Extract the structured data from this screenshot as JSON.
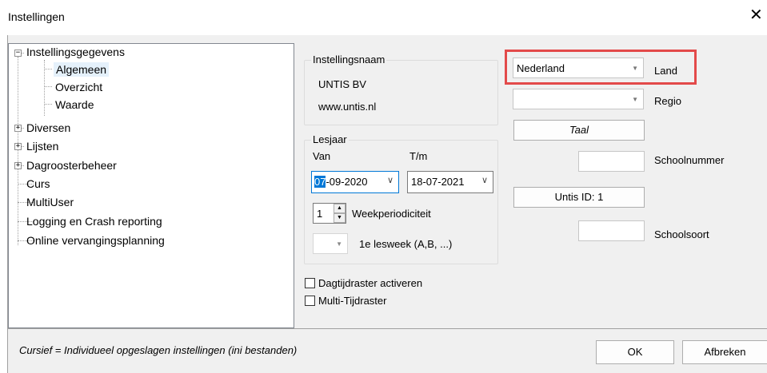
{
  "window": {
    "title": "Instellingen",
    "close_glyph": "✕"
  },
  "tree": {
    "items": [
      {
        "label": "Instellingsgegevens",
        "expander": "−"
      },
      {
        "label": "Algemeen"
      },
      {
        "label": "Overzicht"
      },
      {
        "label": "Waarde"
      },
      {
        "label": "Diversen",
        "expander": "+"
      },
      {
        "label": "Lijsten",
        "expander": "+"
      },
      {
        "label": "Dagroosterbeheer",
        "expander": "+"
      },
      {
        "label": "Curs"
      },
      {
        "label": "MultiUser"
      },
      {
        "label": "Logging en Crash reporting"
      },
      {
        "label": "Online vervangingsplanning"
      }
    ],
    "selected": "Algemeen"
  },
  "instellingsnaam": {
    "legend": "Instellingsnaam",
    "name": "UNTIS BV",
    "website": "www.untis.nl"
  },
  "lesjaar": {
    "legend": "Lesjaar",
    "van_label": "Van",
    "tm_label": "T/m",
    "van_value_selected": "07",
    "van_value_rest": "-09-2020",
    "tm_value": "18-07-2021",
    "week_value": "1",
    "week_label": "Weekperiodiciteit",
    "first_week_label": "1e lesweek (A,B, ...)"
  },
  "options": {
    "dagtijdraster_label": "Dagtijdraster activeren",
    "multi_tijdraster_label": "Multi-Tijdraster",
    "dagtijdraster_checked": false,
    "multi_tijdraster_checked": false
  },
  "right": {
    "land_value": "Nederland",
    "land_label": "Land",
    "regio_value": "",
    "regio_label": "Regio",
    "taal_button": "Taal",
    "schoolnummer_label": "Schoolnummer",
    "schoolnummer_value": "",
    "untis_id_button": "Untis ID: 1",
    "schoolsoort_label": "Schoolsoort",
    "schoolsoort_value": ""
  },
  "footer": {
    "note": "Cursief = Individueel opgeslagen instellingen (ini bestanden)",
    "ok_label": "OK",
    "cancel_label": "Afbreken"
  },
  "colors": {
    "highlight": "#e34a4a",
    "selection": "#e5f1fb",
    "dialog_bg": "#f0f0f0"
  }
}
